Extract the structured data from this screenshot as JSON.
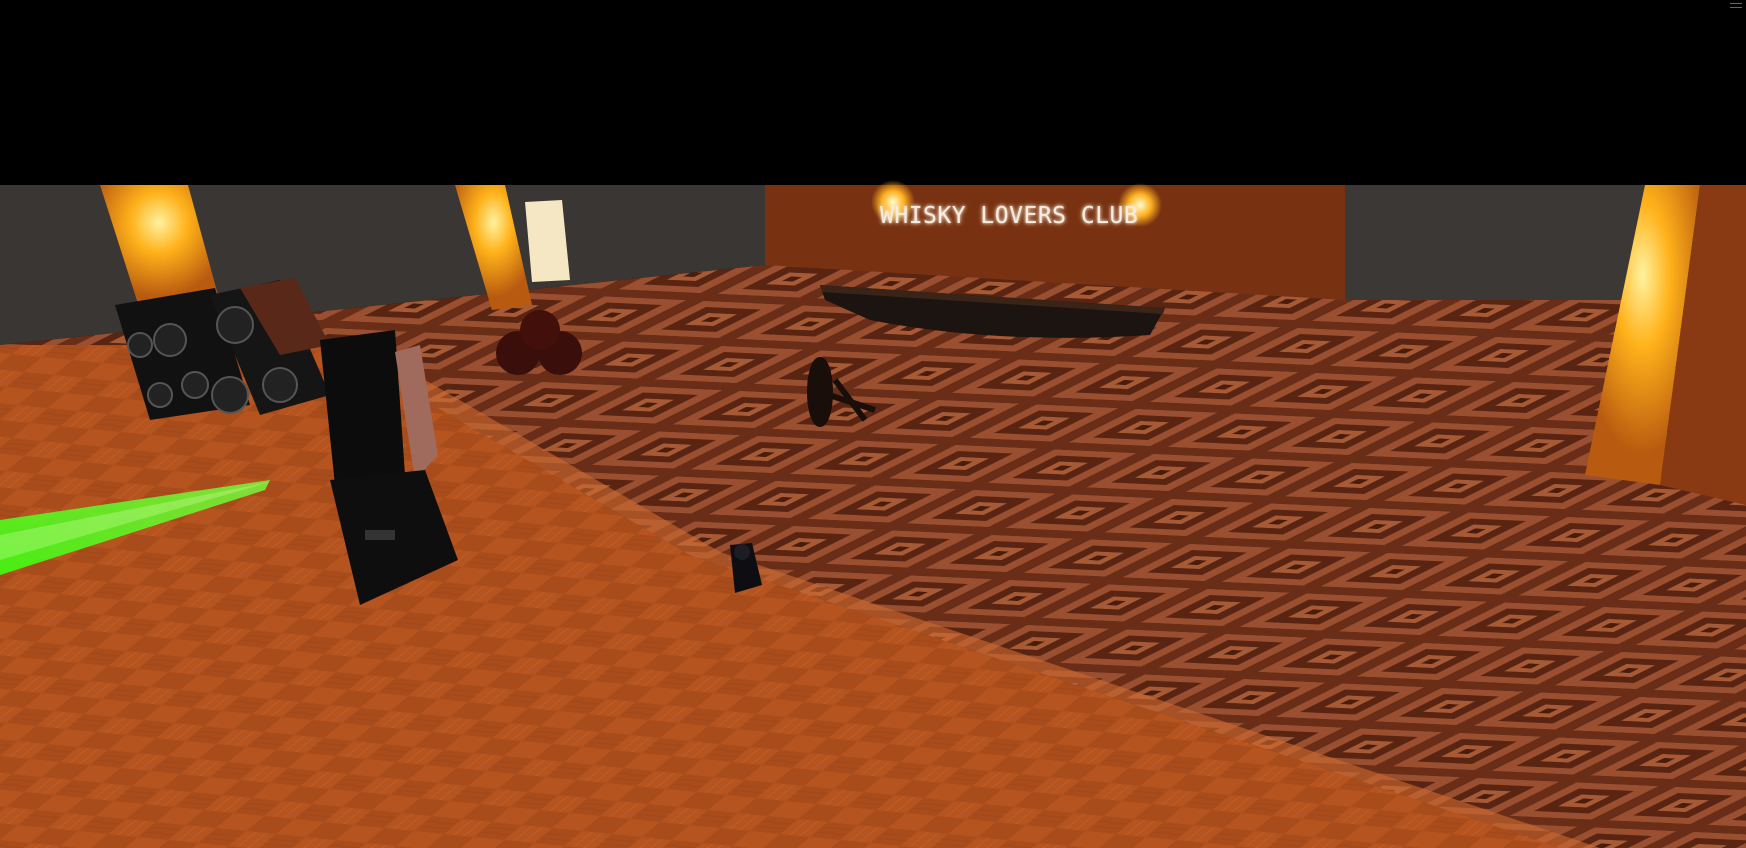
{
  "scene": {
    "sign_text": "WHISKY LOVERS CLUB",
    "colors": {
      "sky": "#000000",
      "wall": "#3c3836",
      "back_wall_stage": "#8a3a14",
      "floor_dark": "#5a2614",
      "floor_light": "#a0532e",
      "dance_floor": "#b5541f",
      "pillar_light": "#ffb21a",
      "laser": "#4cff1a"
    },
    "objects": [
      {
        "name": "speaker-stack-left",
        "icon": "speaker-icon"
      },
      {
        "name": "dj-booth"
      },
      {
        "name": "whisky-barrels"
      },
      {
        "name": "bar-counter"
      },
      {
        "name": "fallen-stool"
      },
      {
        "name": "small-statue"
      },
      {
        "name": "pillar-left-1"
      },
      {
        "name": "pillar-left-2"
      },
      {
        "name": "pillar-right"
      },
      {
        "name": "green-laser-beam"
      }
    ]
  }
}
